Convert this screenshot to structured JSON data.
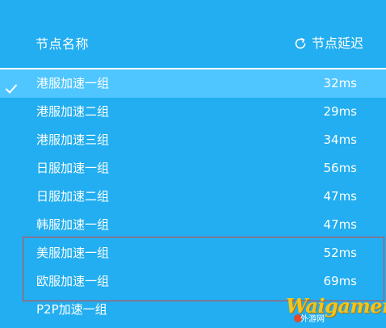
{
  "header": {
    "name_column": "节点名称",
    "latency_column": "节点延迟",
    "refresh_icon": "refresh-icon"
  },
  "rows": [
    {
      "name": "港服加速一组",
      "latency": "32ms",
      "selected": true
    },
    {
      "name": "港服加速二组",
      "latency": "29ms",
      "selected": false
    },
    {
      "name": "港服加速三组",
      "latency": "34ms",
      "selected": false
    },
    {
      "name": "日服加速一组",
      "latency": "56ms",
      "selected": false
    },
    {
      "name": "日服加速二组",
      "latency": "47ms",
      "selected": false
    },
    {
      "name": "韩服加速一组",
      "latency": "47ms",
      "selected": false
    },
    {
      "name": "美服加速一组",
      "latency": "52ms",
      "selected": false
    },
    {
      "name": "欧服加速一组",
      "latency": "69ms",
      "selected": false
    },
    {
      "name": "P2P加速一组",
      "latency": "",
      "selected": false
    }
  ],
  "watermark": {
    "text": "Waigamer",
    "sub": "外游网"
  },
  "colors": {
    "background": "#22aef0",
    "selected_row": "#4fc6ff",
    "highlight_border": "#d6433f",
    "text": "#ffffff"
  }
}
